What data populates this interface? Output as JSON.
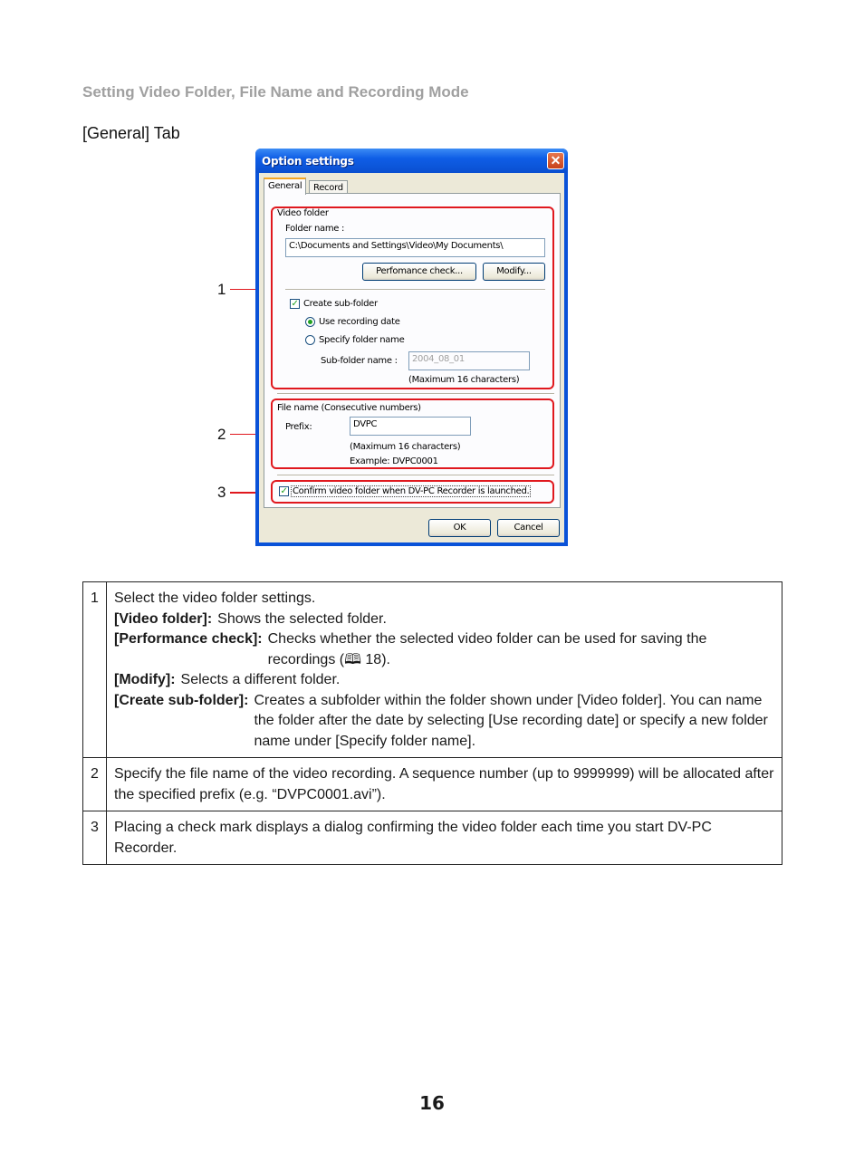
{
  "page": {
    "section_title": "Setting Video Folder, File Name and Recording Mode",
    "sub_title": "[General] Tab",
    "page_number": "16"
  },
  "dialog": {
    "title": "Option settings",
    "close_glyph": "✕",
    "tabs": [
      {
        "label": "General",
        "active": true
      },
      {
        "label": "Record",
        "active": false
      }
    ],
    "video_folder": {
      "group_label": "Video folder",
      "folder_name_label": "Folder name :",
      "folder_path": "C:\\Documents and Settings\\Video\\My Documents\\",
      "performance_check_button": "Perfomance check...",
      "modify_button": "Modify...",
      "create_subfolder_label": "Create sub-folder",
      "create_subfolder_checked": true,
      "radio_use_date": "Use recording date",
      "radio_specify_name": "Specify folder name",
      "selected_radio": "Use recording date",
      "subfolder_name_label": "Sub-folder name :",
      "subfolder_name_value": "2004_08_01",
      "subfolder_hint": "(Maximum 16 characters)"
    },
    "file_name": {
      "group_label": "File name (Consecutive numbers)",
      "prefix_label": "Prefix:",
      "prefix_value": "DVPC",
      "hint": "(Maximum 16 characters)",
      "example": "Example: DVPC0001"
    },
    "confirm_label": "Confirm video folder when DV-PC Recorder is launched.",
    "confirm_checked": true,
    "ok_button": "OK",
    "cancel_button": "Cancel",
    "check_glyph": "✓"
  },
  "callouts": [
    "1",
    "2",
    "3"
  ],
  "highlight_color": "#e0181e",
  "table": {
    "rows": [
      {
        "num": "1",
        "intro": "Select the video folder settings.",
        "items": [
          {
            "term": "[Video folder]:",
            "desc": "Shows the selected folder."
          },
          {
            "term": "[Performance check]:",
            "desc": "Checks whether the selected video folder can be used for saving the recordings (🕮 18)."
          },
          {
            "term": "[Modify]:",
            "desc": "Selects a different folder."
          },
          {
            "term": "[Create sub-folder]:",
            "desc": "Creates a subfolder within the folder shown under [Video folder]. You can name the folder after the date by selecting [Use recording date] or specify a new folder name under [Specify folder name]."
          }
        ]
      },
      {
        "num": "2",
        "text": "Specify the file name of the video recording. A sequence number (up to 9999999) will be allocated after the specified prefix (e.g. “DVPC0001.avi”)."
      },
      {
        "num": "3",
        "text": "Placing a check mark displays a dialog confirming the video folder each time you start DV-PC Recorder."
      }
    ]
  }
}
